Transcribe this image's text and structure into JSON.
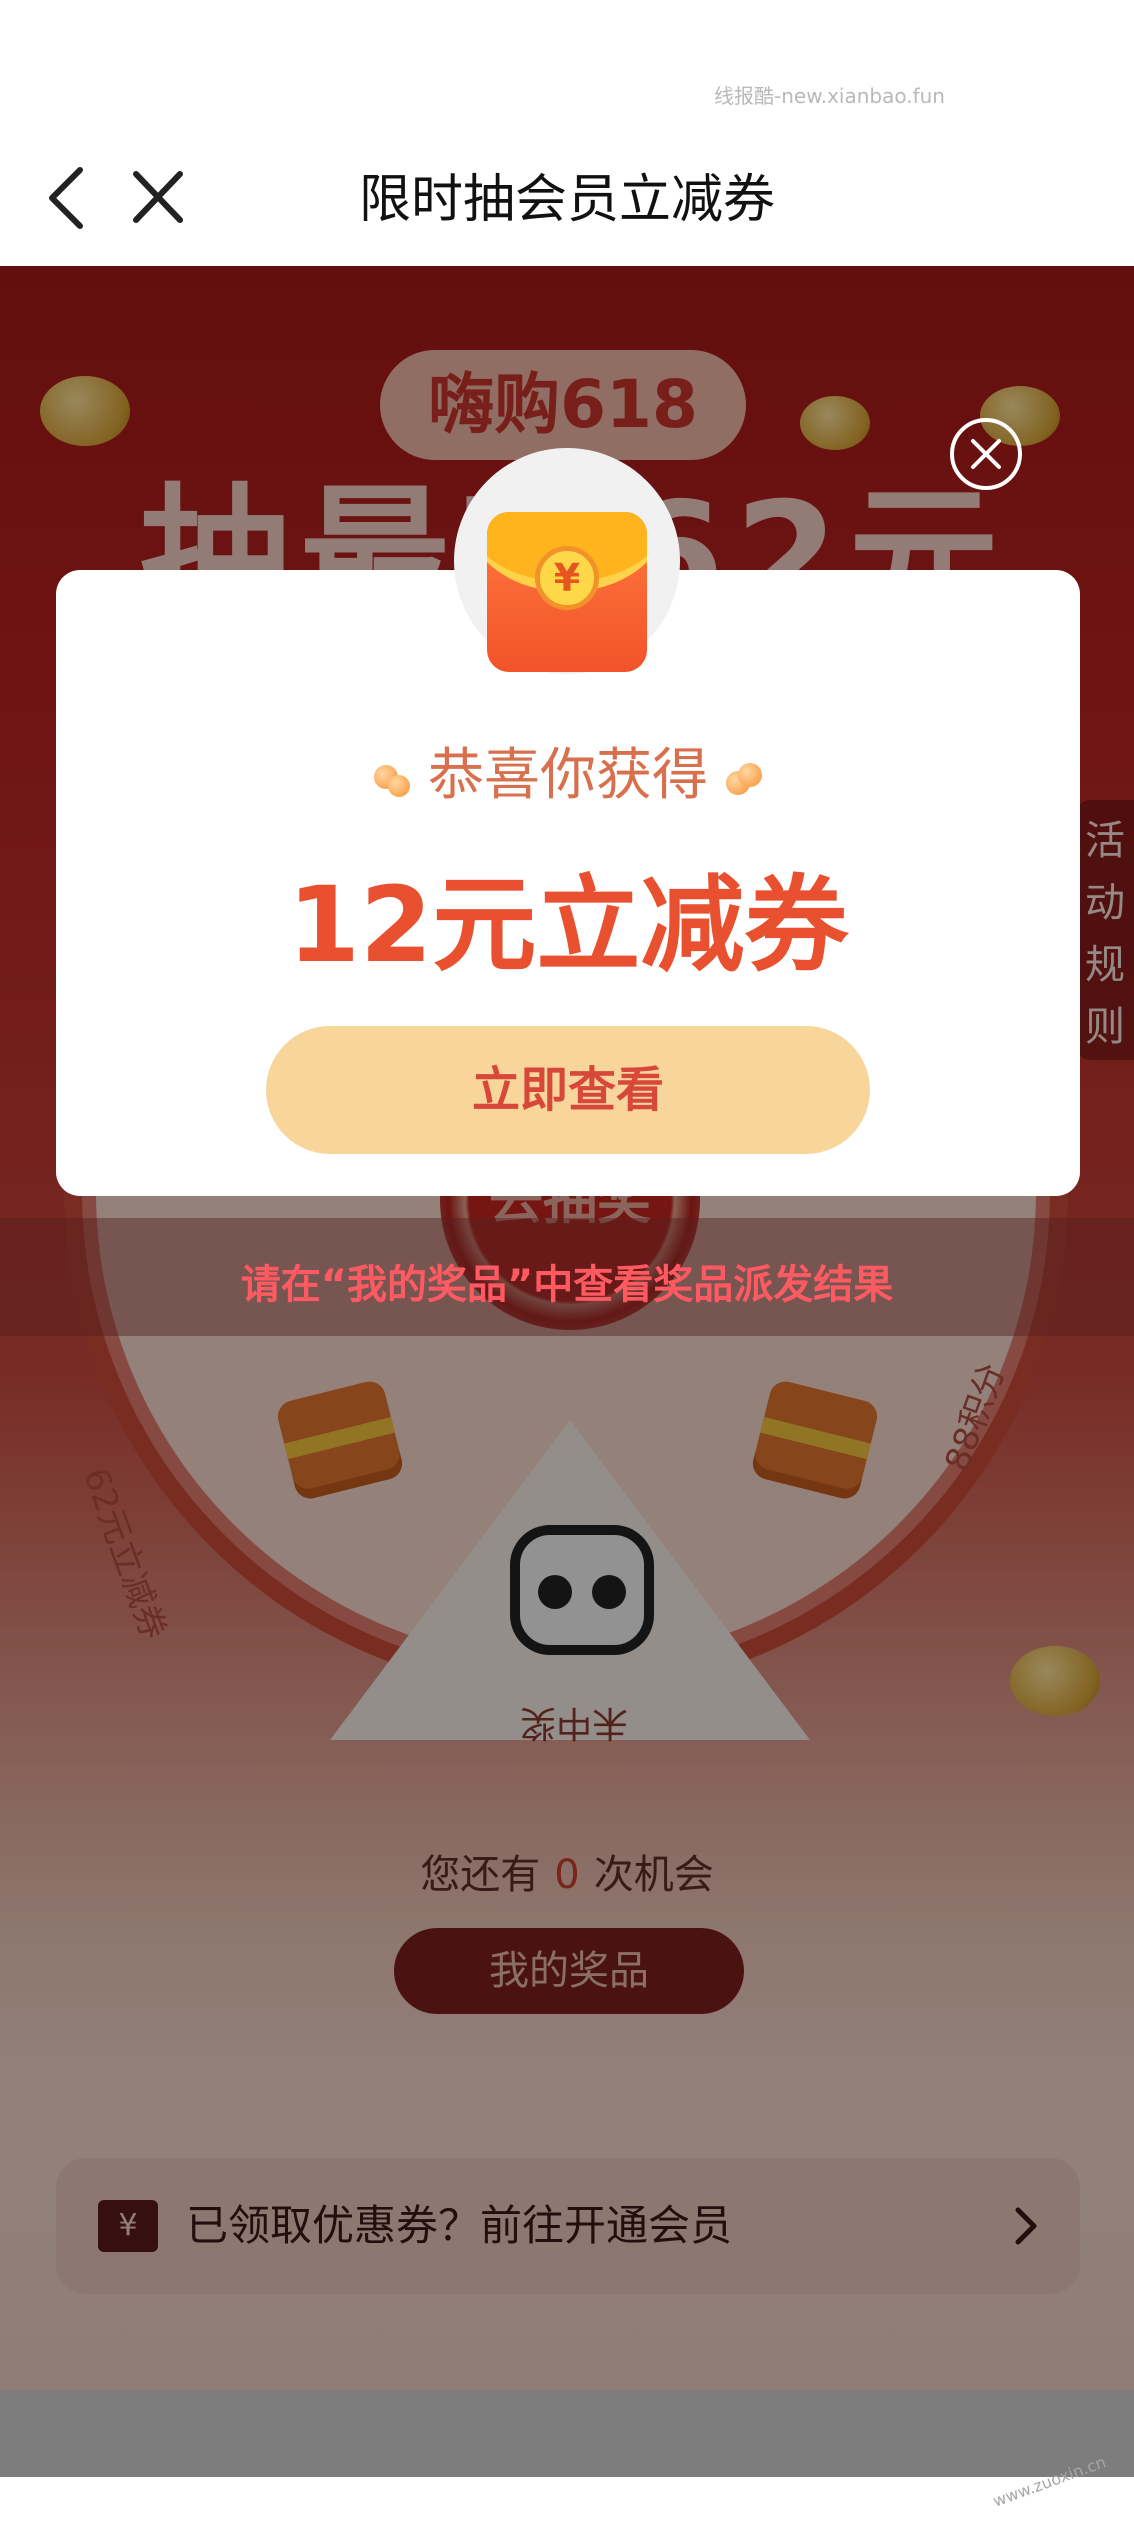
{
  "watermark_top": "线报酷-new.xianbao.fun",
  "nav": {
    "title": "限时抽会员立减券"
  },
  "activity": {
    "banner_pill": "嗨购618",
    "headline": "抽最高62元",
    "rules_tab": [
      "活",
      "动",
      "规",
      "则"
    ],
    "wheel": {
      "center_label": "去抽奖",
      "prizes": [
        "62元立减券",
        "未中奖",
        "88积分"
      ]
    },
    "hint": "请在“我的奖品”中查看奖品派发结果",
    "chances": {
      "prefix": "您还有",
      "count": "0",
      "suffix": "次机会"
    },
    "my_prize_button": "我的奖品",
    "member_bar": {
      "icon_char": "¥",
      "text": "已领取优惠券？前往开通会员"
    }
  },
  "modal": {
    "icon_char": "¥",
    "congrats": "恭喜你获得",
    "prize": "12元立减券",
    "view_button": "立即查看"
  },
  "colors": {
    "accent_orange": "#e8502f",
    "button_cream": "#f7d59b",
    "hint_red": "#ff5a62",
    "page_red": "#b7221f"
  },
  "icons": {
    "back": "chevron-left-icon",
    "close": "close-icon",
    "modal_close": "circle-close-icon",
    "red_packet": "red-packet-icon",
    "ticket": "ticket-icon",
    "chevron": "chevron-right-icon"
  },
  "watermark_bottom": "www.zuoxin.cn"
}
